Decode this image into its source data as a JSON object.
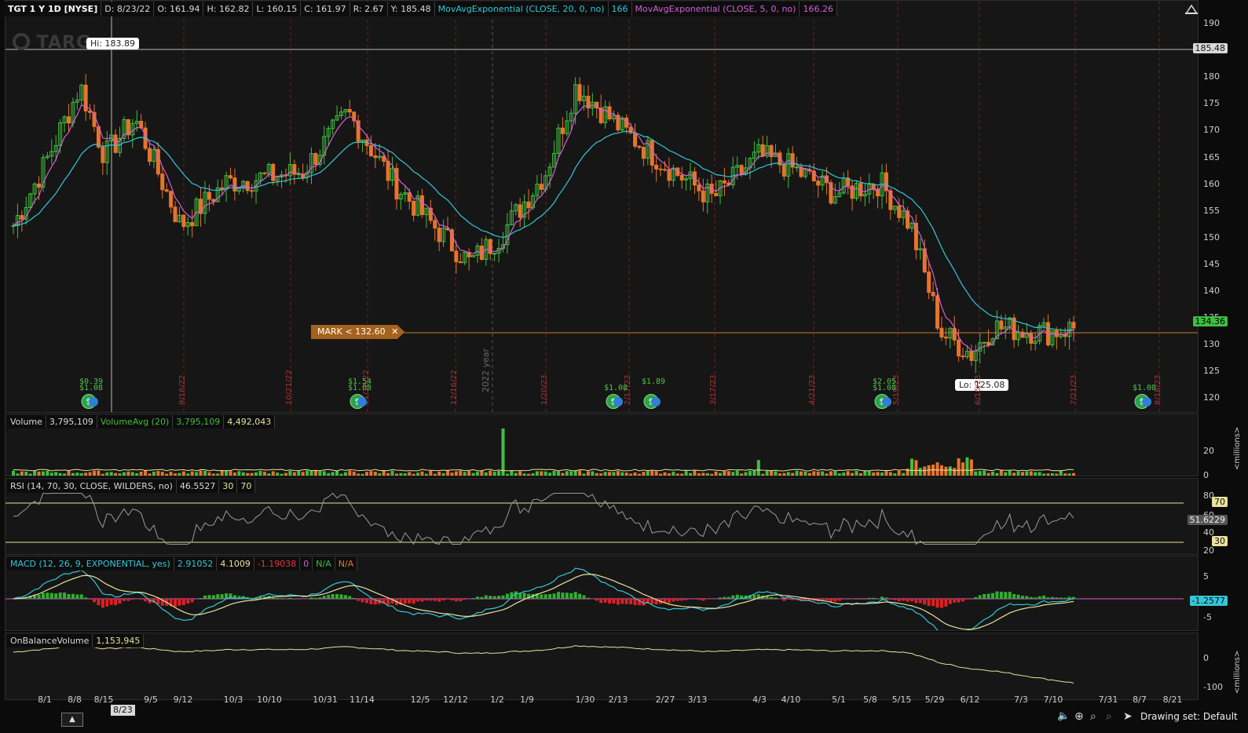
{
  "header": {
    "symbol": "TGT 1 Y 1D [NYSE]",
    "date": "D: 8/23/22",
    "open": "O: 161.94",
    "high": "H: 162.82",
    "low": "L: 160.15",
    "close": "C: 161.97",
    "range": "R: 2.67",
    "y": "Y: 185.48",
    "ma20": "MovAvgExponential (CLOSE, 20, 0, no)",
    "ma20_val": "166",
    "ma5": "MovAvgExponential (CLOSE, 5, 0, no)",
    "ma5_val": "166.26"
  },
  "price_axis": [
    "190",
    "185",
    "180",
    "175",
    "170",
    "165",
    "160",
    "155",
    "150",
    "145",
    "140",
    "135",
    "130",
    "125",
    "120"
  ],
  "price_tags": {
    "cursor": "185.48",
    "last": "134.36"
  },
  "hi_label": "Hi: 183.89",
  "lo_label": "Lo: 125.08",
  "mark_label": "MARK < 132.60",
  "mark_close": "✕",
  "year_label": "2022 year",
  "watermark": "TARG",
  "date_markers": [
    {
      "label": "9/16/22"
    },
    {
      "label": "10/21/22"
    },
    {
      "label": "11/18/22"
    },
    {
      "label": "12/16/22"
    },
    {
      "label": "1/20/23"
    },
    {
      "label": "2/17/23"
    },
    {
      "label": "3/17/23"
    },
    {
      "label": "4/21/23"
    },
    {
      "label": "5/19/23"
    },
    {
      "label": "6/16/23"
    },
    {
      "label": "7/21/23"
    },
    {
      "label": "8/18/23"
    }
  ],
  "events": [
    {
      "top": "$0.39",
      "bottom": "$1.08"
    },
    {
      "top": "$1.54",
      "bottom": "$1.08"
    },
    {
      "top": "$1.89",
      "bottom": ""
    },
    {
      "top": "",
      "bottom": "$1.08"
    },
    {
      "top": "$2.05",
      "bottom": "$1.08"
    },
    {
      "top": "",
      "bottom": "$1.08"
    }
  ],
  "volume": {
    "title": "Volume",
    "value": "3,795,109",
    "avg_label": "VolumeAvg (20)",
    "avg_value": "3,795,109",
    "extra": "4,492,043",
    "axis": [
      "20",
      "0"
    ],
    "unit": "<millions>"
  },
  "rsi": {
    "title": "RSI (14, 70, 30, CLOSE, WILDERS, no)",
    "value": "46.5527",
    "low": "30",
    "high": "70",
    "axis": [
      "80",
      "60",
      "40",
      "20"
    ],
    "tags": {
      "upper": "70",
      "current": "51.6229",
      "lower": "30"
    }
  },
  "macd": {
    "title": "MACD (12, 26, 9, EXPONENTIAL, yes)",
    "value": "2.91052",
    "avg": "4.1009",
    "diff": "-1.19038",
    "zero": "0",
    "na1": "N/A",
    "na2": "N/A",
    "axis": [
      "5",
      "-5"
    ],
    "tag": "-1.2577"
  },
  "obv": {
    "title": "OnBalanceVolume",
    "value": "1,153,945",
    "axis": [
      "0",
      "-100"
    ],
    "unit": "<millions>"
  },
  "x_axis": [
    "8/1",
    "8/8",
    "8/15",
    "9/5",
    "9/12",
    "10/3",
    "10/10",
    "10/31",
    "11/14",
    "12/5",
    "12/12",
    "1/2",
    "1/9",
    "1/30",
    "2/13",
    "2/27",
    "3/13",
    "4/3",
    "4/10",
    "5/1",
    "5/8",
    "5/15",
    "5/29",
    "6/12",
    "7/3",
    "7/10",
    "7/31",
    "8/7",
    "8/21"
  ],
  "cursor_date": "8/23",
  "footer": {
    "drawing_set": "Drawing set: Default"
  },
  "colors": {
    "up": "#3fbf3f",
    "down": "#e8742a",
    "ma20": "#34c6d8",
    "ma5": "#d65fd6",
    "yellow": "#e8e29a",
    "mark": "#a5621c"
  }
}
